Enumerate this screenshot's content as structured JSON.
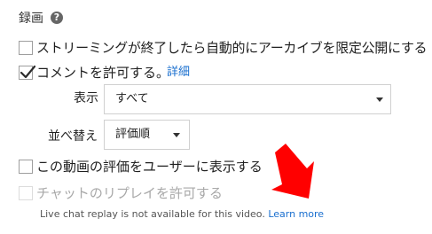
{
  "section": {
    "title": "録画",
    "help_icon": "help-icon",
    "help_glyph": "?"
  },
  "options": {
    "archive_limited": {
      "label": "ストリーミングが終了したら自動的にアーカイブを限定公開にする",
      "checked": false
    },
    "comments": {
      "label": "コメントを許可する。",
      "link": "詳細",
      "checked": true
    },
    "show_ratings": {
      "label": "この動画の評価をユーザーに表示する",
      "checked": false
    },
    "chat_replay": {
      "label": "チャットのリプレイを許可する",
      "checked": false,
      "disabled": true,
      "note": "Live chat replay is not available for this video.",
      "note_link": "Learn more"
    }
  },
  "display": {
    "label": "表示",
    "value": "すべて"
  },
  "sort": {
    "label": "並べ替え",
    "value": "評価順"
  },
  "annotation": {
    "arrow_color": "#ff0000",
    "icon": "red-arrow-icon"
  }
}
